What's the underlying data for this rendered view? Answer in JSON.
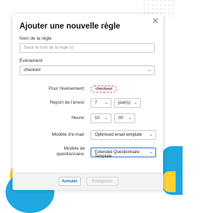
{
  "modal": {
    "title": "Ajouter une nouvelle règle",
    "close_icon": "close-icon",
    "rule_name": {
      "label": "Nom de la règle",
      "value": "",
      "placeholder": "Saisir le nom de la règle ici"
    },
    "event": {
      "label": "Événement",
      "selected": "checkout"
    },
    "for_event": {
      "label": "Pour l'événement:",
      "badge": "checkout"
    },
    "delay": {
      "label": "Report de l'envoi:",
      "amount": "7",
      "unit": "jour(s)"
    },
    "time": {
      "label": "Heure:",
      "hour": "10",
      "minute": "00"
    },
    "email_model": {
      "label": "Modèle d'e-mail:",
      "selected": "Optimised email template"
    },
    "questionnaire_model": {
      "label_line1": "Modèle de",
      "label_line2": "questionnaire:",
      "selected": "Extended Questionnaire Template"
    },
    "buttons": {
      "cancel": "Annuler",
      "save": "Enregistrer"
    }
  },
  "colors": {
    "accent": "#1b6bc5",
    "badge_border": "#e0506a",
    "decor_blue": "#1ea7e1",
    "decor_yellow": "#ffd233"
  }
}
